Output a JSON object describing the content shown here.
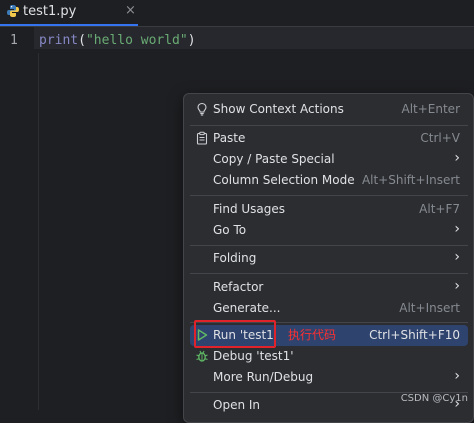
{
  "tab": {
    "filename": "test1.py",
    "close_glyph": "×",
    "icon": "python-file-icon"
  },
  "editor": {
    "line_number": "1",
    "code": {
      "fn": "print",
      "open": "(",
      "string": "\"hello world\"",
      "close": ")"
    }
  },
  "menu": {
    "items": [
      {
        "label": "Show Context Actions",
        "shortcut": "Alt+Enter",
        "icon": "lightbulb-icon"
      },
      {
        "label": "Paste",
        "shortcut": "Ctrl+V",
        "icon": "clipboard-icon"
      },
      {
        "label": "Copy / Paste Special",
        "submenu": true
      },
      {
        "label": "Column Selection Mode",
        "shortcut": "Alt+Shift+Insert"
      },
      {
        "label": "Find Usages",
        "shortcut": "Alt+F7"
      },
      {
        "label": "Go To",
        "submenu": true
      },
      {
        "label": "Folding",
        "submenu": true
      },
      {
        "label": "Refactor",
        "submenu": true
      },
      {
        "label": "Generate...",
        "shortcut": "Alt+Insert"
      },
      {
        "label": "Run 'test1'",
        "shortcut": "Ctrl+Shift+F10",
        "icon": "run-icon",
        "selected": true
      },
      {
        "label": "Debug 'test1'",
        "icon": "debug-icon"
      },
      {
        "label": "More Run/Debug",
        "submenu": true
      },
      {
        "label": "Open In",
        "submenu": true
      }
    ],
    "submenu_glyph": "›"
  },
  "annotation": {
    "text": "执行代码",
    "color": "#e0222a"
  },
  "watermark": "CSDN @Cy1n",
  "colors": {
    "accent": "#3574f0",
    "selection": "#2e436e",
    "run_green": "#5fb865",
    "string_green": "#6aab73"
  }
}
